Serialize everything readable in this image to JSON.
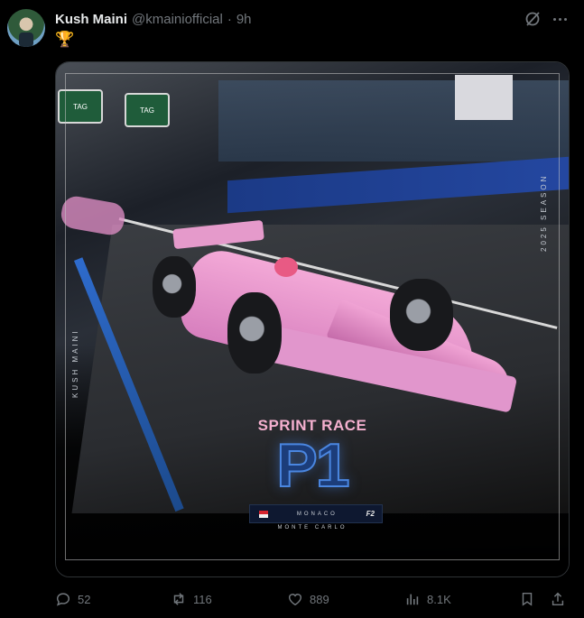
{
  "post": {
    "author_name": "Kush Maini",
    "handle": "@kmainiofficial",
    "separator": "·",
    "time": "9h",
    "body_emoji": "🏆"
  },
  "media": {
    "title": "SPRINT RACE",
    "position": "P1",
    "location": "MONACO",
    "circuit": "MONTE CARLO",
    "season": "2025 SEASON",
    "driver_vertical": "KUSH MAINI",
    "series_logo": "F2",
    "sponsor_board": "TAG"
  },
  "actions": {
    "replies": "52",
    "reposts": "116",
    "likes": "889",
    "views": "8.1K"
  },
  "colors": {
    "background": "#000000",
    "muted": "#71767b",
    "text": "#e7e9ea",
    "car_pink": "#f3a9d7",
    "p1_blue": "#4a86e0"
  }
}
